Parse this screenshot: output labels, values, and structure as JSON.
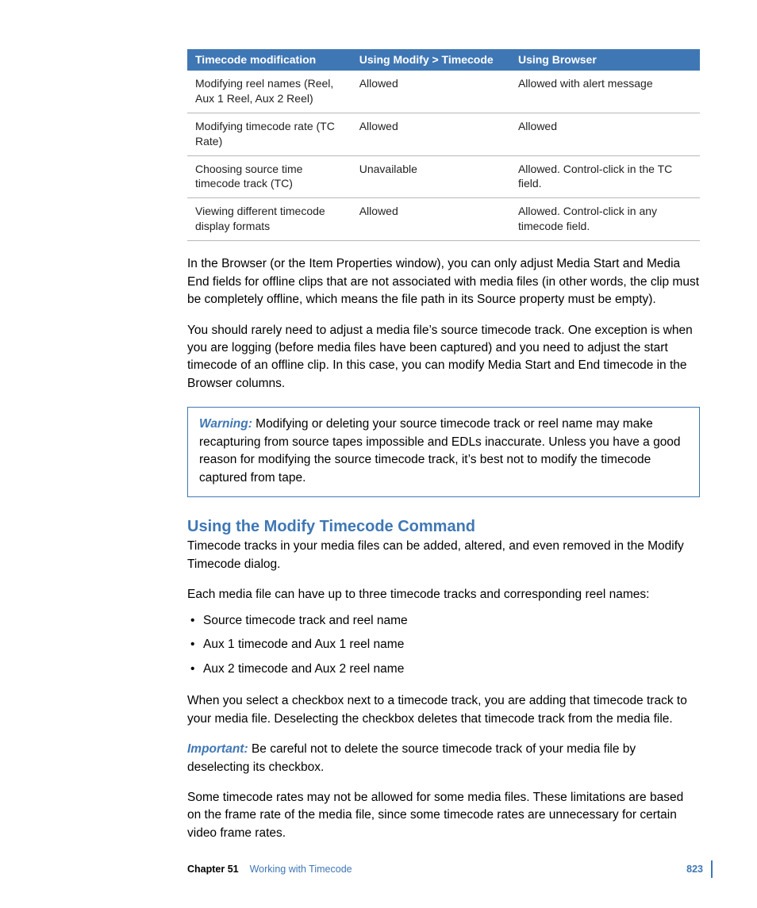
{
  "table": {
    "headers": [
      "Timecode modification",
      "Using Modify > Timecode",
      "Using Browser"
    ],
    "rows": [
      {
        "c1": "Modifying reel names (Reel, Aux 1 Reel, Aux 2 Reel)",
        "c2": "Allowed",
        "c3": "Allowed with alert message"
      },
      {
        "c1": "Modifying timecode rate (TC Rate)",
        "c2": "Allowed",
        "c3": "Allowed"
      },
      {
        "c1": "Choosing source time timecode track (TC)",
        "c2": "Unavailable",
        "c3": "Allowed. Control-click in the TC field."
      },
      {
        "c1": "Viewing different timecode display formats",
        "c2": "Allowed",
        "c3": "Allowed. Control-click in any timecode field."
      }
    ]
  },
  "paras": {
    "p1": "In the Browser (or the Item Properties window), you can only adjust Media Start and Media End fields for offline clips that are not associated with media files (in other words, the clip must be completely offline, which means the file path in its Source property must be empty).",
    "p2": "You should rarely need to adjust a media file’s source timecode track. One exception is when you are logging (before media files have been captured) and you need to adjust the start timecode of an offline clip. In this case, you can modify Media Start and End timecode in the Browser columns."
  },
  "warning": {
    "label": "Warning:",
    "text": "  Modifying or deleting your source timecode track or reel name may make recapturing from source tapes impossible and EDLs inaccurate. Unless you have a good reason for modifying the source timecode track, it’s best not to modify the timecode captured from tape."
  },
  "section": {
    "title": "Using the Modify Timecode Command",
    "p1": "Timecode tracks in your media files can be added, altered, and even removed in the Modify Timecode dialog.",
    "p2": "Each media file can have up to three timecode tracks and corresponding reel names:",
    "bullets": [
      "Source timecode track and reel name",
      "Aux 1 timecode and Aux 1 reel name",
      "Aux 2 timecode and Aux 2 reel name"
    ],
    "p3": "When you select a checkbox next to a timecode track, you are adding that timecode track to your media file. Deselecting the checkbox deletes that timecode track from the media file.",
    "important_label": "Important:",
    "important_text": "  Be careful not to delete the source timecode track of your media file by deselecting its checkbox.",
    "p4": "Some timecode rates may not be allowed for some media files. These limitations are based on the frame rate of the media file, since some timecode rates are unnecessary for certain video frame rates."
  },
  "footer": {
    "chapter_label": "Chapter 51",
    "chapter_title": "Working with Timecode",
    "page": "823"
  }
}
